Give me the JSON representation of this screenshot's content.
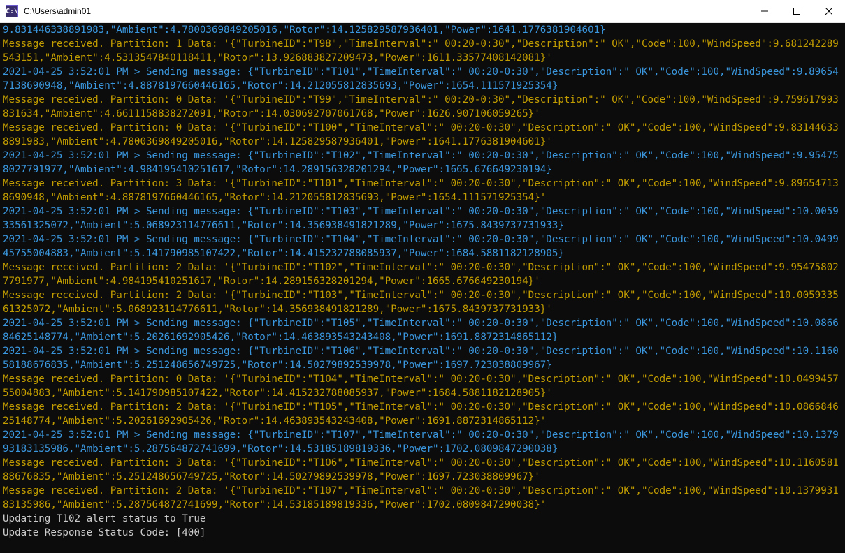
{
  "window": {
    "title": "C:\\Users\\admin01",
    "icon_label": "C:\\"
  },
  "terminal": {
    "lines": [
      {
        "style": "cyan",
        "text": "9.831446338891983,\"Ambient\":4.7800369849205016,\"Rotor\":14.125829587936401,\"Power\":1641.1776381904601}"
      },
      {
        "style": "yellow",
        "text": "Message received. Partition: 1 Data: '{\"TurbineID\":\"T98\",\"TimeInterval\":\" 00:20-0:30\",\"Description\":\" OK\",\"Code\":100,\"WindSpeed\":9.681242289543151,\"Ambient\":4.5313547840118411,\"Rotor\":13.926883827209473,\"Power\":1611.33577408142081}'"
      },
      {
        "style": "cyan",
        "text": "2021-04-25 3:52:01 PM > Sending message: {\"TurbineID\":\"T101\",\"TimeInterval\":\" 00:20-0:30\",\"Description\":\" OK\",\"Code\":100,\"WindSpeed\":9.896547138690948,\"Ambient\":4.8878197660446165,\"Rotor\":14.212055812835693,\"Power\":1654.111571925354}"
      },
      {
        "style": "yellow",
        "text": "Message received. Partition: 0 Data: '{\"TurbineID\":\"T99\",\"TimeInterval\":\" 00:20-0:30\",\"Description\":\" OK\",\"Code\":100,\"WindSpeed\":9.759617993831634,\"Ambient\":4.6611158838272091,\"Rotor\":14.030692707061768,\"Power\":1626.907106059265}'"
      },
      {
        "style": "yellow",
        "text": "Message received. Partition: 0 Data: '{\"TurbineID\":\"T100\",\"TimeInterval\":\" 00:20-0:30\",\"Description\":\" OK\",\"Code\":100,\"WindSpeed\":9.831446338891983,\"Ambient\":4.7800369849205016,\"Rotor\":14.125829587936401,\"Power\":1641.1776381904601}'"
      },
      {
        "style": "cyan",
        "text": "2021-04-25 3:52:01 PM > Sending message: {\"TurbineID\":\"T102\",\"TimeInterval\":\" 00:20-0:30\",\"Description\":\" OK\",\"Code\":100,\"WindSpeed\":9.954758027791977,\"Ambient\":4.984195410251617,\"Rotor\":14.289156328201294,\"Power\":1665.676649230194}"
      },
      {
        "style": "yellow",
        "text": "Message received. Partition: 3 Data: '{\"TurbineID\":\"T101\",\"TimeInterval\":\" 00:20-0:30\",\"Description\":\" OK\",\"Code\":100,\"WindSpeed\":9.896547138690948,\"Ambient\":4.8878197660446165,\"Rotor\":14.212055812835693,\"Power\":1654.111571925354}'"
      },
      {
        "style": "cyan",
        "text": "2021-04-25 3:52:01 PM > Sending message: {\"TurbineID\":\"T103\",\"TimeInterval\":\" 00:20-0:30\",\"Description\":\" OK\",\"Code\":100,\"WindSpeed\":10.005933561325072,\"Ambient\":5.068923114776611,\"Rotor\":14.356938491821289,\"Power\":1675.8439737731933}"
      },
      {
        "style": "cyan",
        "text": "2021-04-25 3:52:01 PM > Sending message: {\"TurbineID\":\"T104\",\"TimeInterval\":\" 00:20-0:30\",\"Description\":\" OK\",\"Code\":100,\"WindSpeed\":10.049945755004883,\"Ambient\":5.141790985107422,\"Rotor\":14.415232788085937,\"Power\":1684.5881182128905}"
      },
      {
        "style": "yellow",
        "text": "Message received. Partition: 2 Data: '{\"TurbineID\":\"T102\",\"TimeInterval\":\" 00:20-0:30\",\"Description\":\" OK\",\"Code\":100,\"WindSpeed\":9.954758027791977,\"Ambient\":4.984195410251617,\"Rotor\":14.289156328201294,\"Power\":1665.676649230194}'"
      },
      {
        "style": "yellow",
        "text": "Message received. Partition: 2 Data: '{\"TurbineID\":\"T103\",\"TimeInterval\":\" 00:20-0:30\",\"Description\":\" OK\",\"Code\":100,\"WindSpeed\":10.005933561325072,\"Ambient\":5.068923114776611,\"Rotor\":14.356938491821289,\"Power\":1675.8439737731933}'"
      },
      {
        "style": "cyan",
        "text": "2021-04-25 3:52:01 PM > Sending message: {\"TurbineID\":\"T105\",\"TimeInterval\":\" 00:20-0:30\",\"Description\":\" OK\",\"Code\":100,\"WindSpeed\":10.086684625148774,\"Ambient\":5.20261692905426,\"Rotor\":14.463893543243408,\"Power\":1691.8872314865112}"
      },
      {
        "style": "cyan",
        "text": "2021-04-25 3:52:01 PM > Sending message: {\"TurbineID\":\"T106\",\"TimeInterval\":\" 00:20-0:30\",\"Description\":\" OK\",\"Code\":100,\"WindSpeed\":10.116058188676835,\"Ambient\":5.251248656749725,\"Rotor\":14.50279892539978,\"Power\":1697.723038809967}"
      },
      {
        "style": "yellow",
        "text": "Message received. Partition: 0 Data: '{\"TurbineID\":\"T104\",\"TimeInterval\":\" 00:20-0:30\",\"Description\":\" OK\",\"Code\":100,\"WindSpeed\":10.049945755004883,\"Ambient\":5.141790985107422,\"Rotor\":14.415232788085937,\"Power\":1684.5881182128905}'"
      },
      {
        "style": "yellow",
        "text": "Message received. Partition: 2 Data: '{\"TurbineID\":\"T105\",\"TimeInterval\":\" 00:20-0:30\",\"Description\":\" OK\",\"Code\":100,\"WindSpeed\":10.086684625148774,\"Ambient\":5.20261692905426,\"Rotor\":14.463893543243408,\"Power\":1691.8872314865112}'"
      },
      {
        "style": "cyan",
        "text": "2021-04-25 3:52:01 PM > Sending message: {\"TurbineID\":\"T107\",\"TimeInterval\":\" 00:20-0:30\",\"Description\":\" OK\",\"Code\":100,\"WindSpeed\":10.137993183135986,\"Ambient\":5.287564872741699,\"Rotor\":14.53185189819336,\"Power\":1702.0809847290038}"
      },
      {
        "style": "yellow",
        "text": "Message received. Partition: 3 Data: '{\"TurbineID\":\"T106\",\"TimeInterval\":\" 00:20-0:30\",\"Description\":\" OK\",\"Code\":100,\"WindSpeed\":10.116058188676835,\"Ambient\":5.251248656749725,\"Rotor\":14.50279892539978,\"Power\":1697.723038809967}'"
      },
      {
        "style": "yellow",
        "text": "Message received. Partition: 2 Data: '{\"TurbineID\":\"T107\",\"TimeInterval\":\" 00:20-0:30\",\"Description\":\" OK\",\"Code\":100,\"WindSpeed\":10.137993183135986,\"Ambient\":5.287564872741699,\"Rotor\":14.53185189819336,\"Power\":1702.0809847290038}'"
      },
      {
        "style": "white",
        "text": "Updating T102 alert status to True"
      },
      {
        "style": "white",
        "text": "Update Response Status Code: [400]"
      }
    ]
  }
}
